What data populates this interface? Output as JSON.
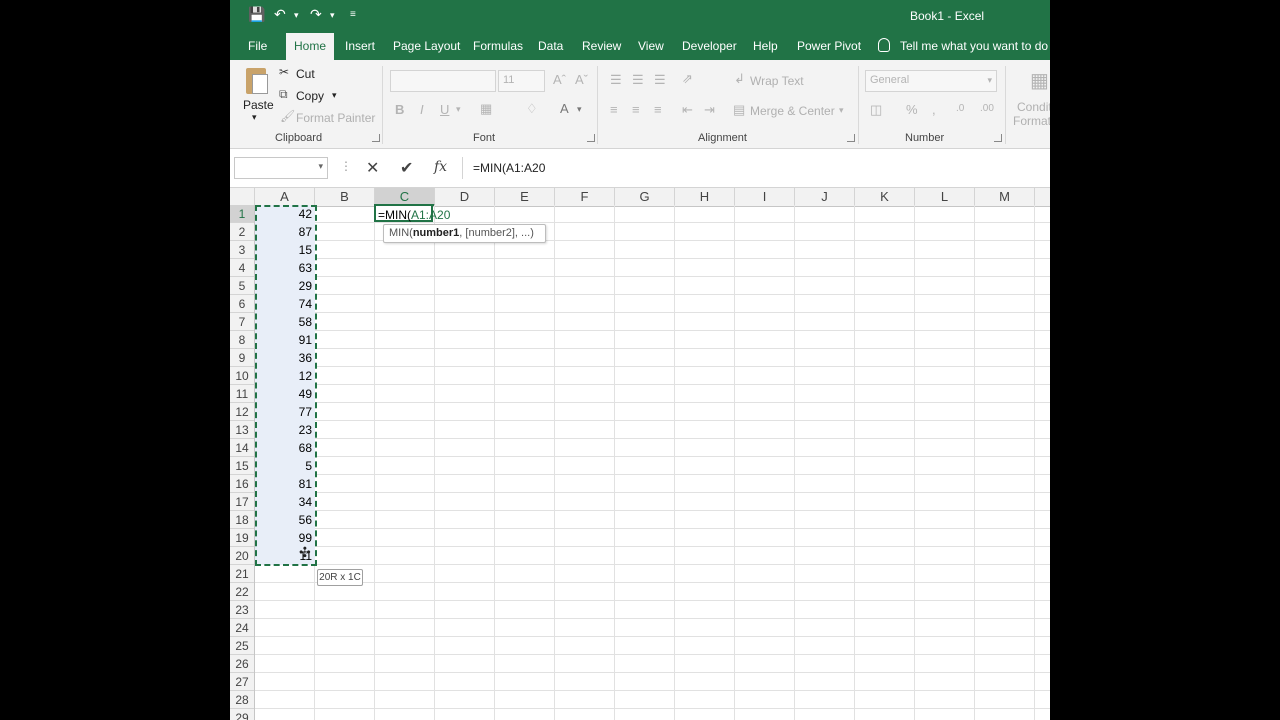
{
  "window": {
    "title": "Book1  -  Excel",
    "accent": "#217346"
  },
  "tabs": [
    "File",
    "Home",
    "Insert",
    "Page Layout",
    "Formulas",
    "Data",
    "Review",
    "View",
    "Developer",
    "Help",
    "Power Pivot"
  ],
  "active_tab": "Home",
  "tell_me": "Tell me what you want to do",
  "ribbon": {
    "clipboard": {
      "paste": "Paste",
      "cut": "Cut",
      "copy": "Copy",
      "format_painter": "Format Painter",
      "label": "Clipboard"
    },
    "font": {
      "size": "11",
      "label": "Font"
    },
    "alignment": {
      "wrap_text": "Wrap Text",
      "merge_center": "Merge & Center",
      "label": "Alignment"
    },
    "number": {
      "format": "General",
      "label": "Number"
    },
    "styles": {
      "cond1": "Conditi",
      "cond2": "Formatti"
    }
  },
  "formula_bar": {
    "fx": "fx",
    "value": "=MIN(A1:A20"
  },
  "columns": [
    "A",
    "B",
    "C",
    "D",
    "E",
    "F",
    "G",
    "H",
    "I",
    "J",
    "K",
    "L",
    "M"
  ],
  "rows": [
    "1",
    "2",
    "3",
    "4",
    "5",
    "6",
    "7",
    "8",
    "9",
    "10",
    "11",
    "12",
    "13",
    "14",
    "15",
    "16",
    "17",
    "18",
    "19",
    "20",
    "21",
    "22",
    "23",
    "24",
    "25",
    "26",
    "27",
    "28",
    "29"
  ],
  "column_a_values": [
    "42",
    "87",
    "15",
    "63",
    "29",
    "74",
    "58",
    "91",
    "36",
    "12",
    "49",
    "77",
    "23",
    "68",
    "5",
    "81",
    "34",
    "56",
    "99",
    "11"
  ],
  "active_cell": {
    "prefix": "=MIN(",
    "ref": "A1:A20"
  },
  "tooltip": {
    "fn": "MIN(",
    "arg1": "number1",
    "rest": ", [number2], ...)"
  },
  "size_tip": "20R x 1C"
}
